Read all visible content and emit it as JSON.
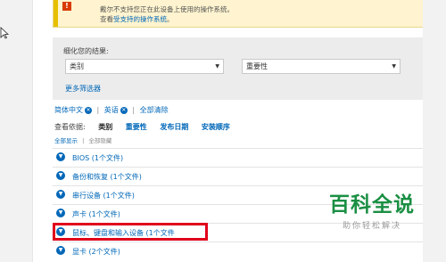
{
  "alert": {
    "line1": "戴尔不支持您正在此设备上使用的操作系统。",
    "line2_prefix": "查看",
    "line2_link": "受支持的操作系统",
    "line2_suffix": "。"
  },
  "refine": {
    "title": "细化您的结果:",
    "category_value": "类别",
    "importance_value": "重要性",
    "more_filters": "更多筛选器"
  },
  "chips": [
    {
      "label": "简体中文"
    },
    {
      "label": "英语"
    }
  ],
  "clear_all": "全部清除",
  "sort": {
    "label": "查看依据:",
    "options": [
      "类别",
      "重要性",
      "发布日期",
      "安装顺序"
    ]
  },
  "show": {
    "show_all": "全部显示",
    "hide_all": "全部隐藏"
  },
  "categories": [
    "BIOS (1个文件)",
    "备份和恢复 (1个文件)",
    "串行设备 (1个文件)",
    "声卡 (1个文件)",
    "鼠标、键盘和输入设备 (1个文件",
    "显卡 (2个文件)"
  ],
  "watermark": {
    "main": "百科全说",
    "sub": "助你轻松解决"
  },
  "colors": {
    "link": "#0067b8",
    "highlight": "#e0001b",
    "watermark": "#1a8f43"
  }
}
